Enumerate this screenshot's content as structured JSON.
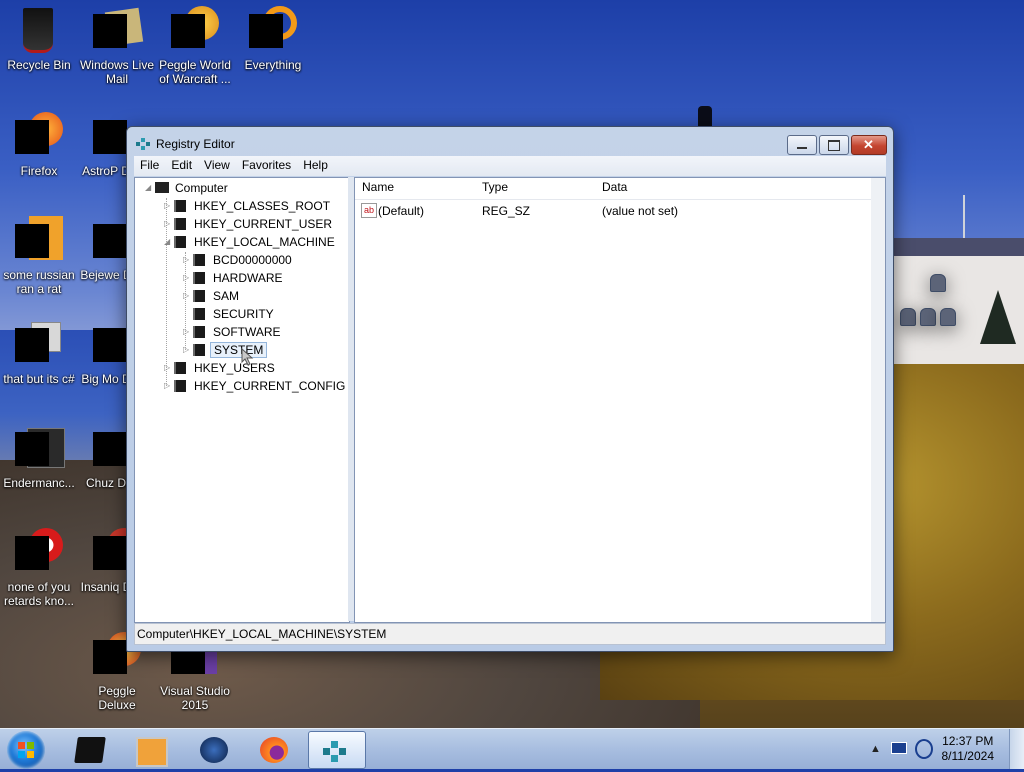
{
  "desktop": {
    "icons": [
      {
        "label": "Recycle Bin"
      },
      {
        "label": "Windows Live Mail"
      },
      {
        "label": "Peggle World of Warcraft ..."
      },
      {
        "label": "Everything"
      },
      {
        "label": "Firefox"
      },
      {
        "label": "AstroP Delux"
      },
      {
        "label": "some russian ran a rat"
      },
      {
        "label": "Bejewe Delux"
      },
      {
        "label": "that but its c#"
      },
      {
        "label": "Big Mo Delux"
      },
      {
        "label": "Endermanc..."
      },
      {
        "label": "Chuz Delux"
      },
      {
        "label": "none of you retards kno..."
      },
      {
        "label": "Insaniq Delux"
      },
      {
        "label": "Peggle Deluxe"
      },
      {
        "label": "Visual Studio 2015"
      }
    ]
  },
  "window": {
    "title": "Registry Editor",
    "menu": [
      "File",
      "Edit",
      "View",
      "Favorites",
      "Help"
    ],
    "tree": {
      "root": "Computer",
      "hives": [
        "HKEY_CLASSES_ROOT",
        "HKEY_CURRENT_USER",
        "HKEY_LOCAL_MACHINE",
        "HKEY_USERS",
        "HKEY_CURRENT_CONFIG"
      ],
      "hklm_children": [
        "BCD00000000",
        "HARDWARE",
        "SAM",
        "SECURITY",
        "SOFTWARE",
        "SYSTEM"
      ],
      "selected": "SYSTEM"
    },
    "list": {
      "columns": [
        "Name",
        "Type",
        "Data"
      ],
      "rows": [
        {
          "name": "(Default)",
          "type": "REG_SZ",
          "data": "(value not set)",
          "icon": "string-value-icon"
        }
      ]
    },
    "status": "Computer\\HKEY_LOCAL_MACHINE\\SYSTEM"
  },
  "taskbar": {
    "clock_time": "12:37 PM",
    "clock_date": "8/11/2024",
    "items": [
      "app-1",
      "media-player",
      "globe-app",
      "firefox",
      "registry-editor"
    ]
  },
  "colors": {
    "selection_bg": "#e8f1fb",
    "title_close": "#c44530"
  }
}
